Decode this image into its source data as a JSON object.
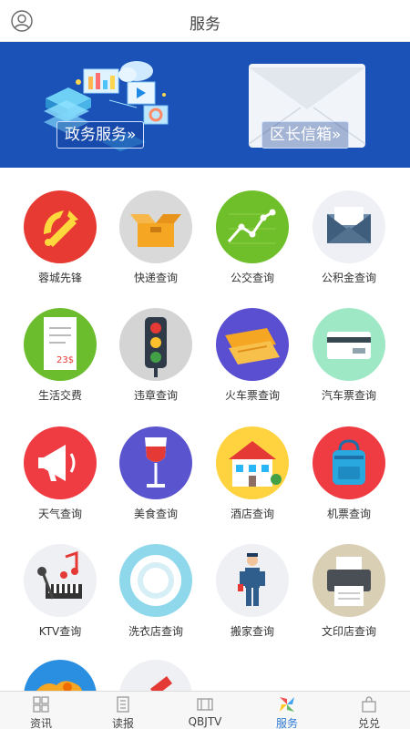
{
  "header": {
    "title": "服务"
  },
  "banner": {
    "gov_button": "政务服务»",
    "mail_button": "区长信箱»"
  },
  "services": [
    {
      "label": "蓉城先锋",
      "icon": "party-emblem-icon"
    },
    {
      "label": "快递查询",
      "icon": "package-box-icon"
    },
    {
      "label": "公交查询",
      "icon": "route-chart-icon"
    },
    {
      "label": "公积金查询",
      "icon": "envelope-icon"
    },
    {
      "label": "生活交费",
      "icon": "receipt-icon"
    },
    {
      "label": "违章查询",
      "icon": "traffic-light-icon"
    },
    {
      "label": "火车票查询",
      "icon": "train-ticket-icon"
    },
    {
      "label": "汽车票查询",
      "icon": "bus-ticket-card-icon"
    },
    {
      "label": "天气查询",
      "icon": "megaphone-icon"
    },
    {
      "label": "美食查询",
      "icon": "wine-glass-icon"
    },
    {
      "label": "酒店查询",
      "icon": "hotel-building-icon"
    },
    {
      "label": "机票查询",
      "icon": "backpack-icon"
    },
    {
      "label": "KTV查询",
      "icon": "microphone-piano-icon"
    },
    {
      "label": "洗衣店查询",
      "icon": "washing-machine-icon"
    },
    {
      "label": "搬家查询",
      "icon": "mover-worker-icon"
    },
    {
      "label": "文印店查询",
      "icon": "printer-icon"
    }
  ],
  "receipt_text": "23$",
  "tabs": [
    {
      "label": "资讯",
      "icon": "grid-icon"
    },
    {
      "label": "读报",
      "icon": "newspaper-icon"
    },
    {
      "label": "QBJTV",
      "icon": "film-icon"
    },
    {
      "label": "服务",
      "icon": "pinwheel-icon",
      "active": true
    },
    {
      "label": "兑兑",
      "icon": "bag-icon"
    }
  ],
  "colors": {
    "banner": "#1a52b7",
    "active_tab": "#2f7ad6"
  }
}
